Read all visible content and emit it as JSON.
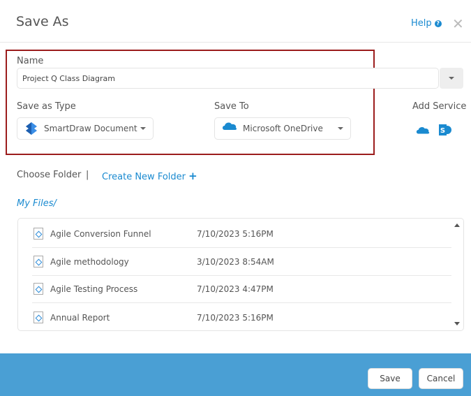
{
  "dialog": {
    "title": "Save As",
    "help_label": "Help",
    "help_icon": "?"
  },
  "name": {
    "label": "Name",
    "value": "Project Q Class Diagram"
  },
  "save_as_type": {
    "label": "Save as Type",
    "value": "SmartDraw Document"
  },
  "save_to": {
    "label": "Save To",
    "value": "Microsoft OneDrive"
  },
  "add_service": {
    "label": "Add Service"
  },
  "folder": {
    "choose_label": "Choose Folder",
    "separator": "|",
    "create_label": "Create New Folder",
    "plus": "+",
    "path": "My Files/"
  },
  "files": [
    {
      "name": "Agile Conversion Funnel",
      "date": "7/10/2023 5:16PM"
    },
    {
      "name": "Agile methodology",
      "date": "3/10/2023 8:54AM"
    },
    {
      "name": "Agile Testing Process",
      "date": "7/10/2023 4:47PM"
    },
    {
      "name": "Annual Report",
      "date": "7/10/2023 5:16PM"
    }
  ],
  "footer": {
    "save_label": "Save",
    "cancel_label": "Cancel"
  },
  "colors": {
    "accent": "#1a8ad0",
    "footer": "#4a9fd4",
    "highlight": "#9b1c1c"
  }
}
